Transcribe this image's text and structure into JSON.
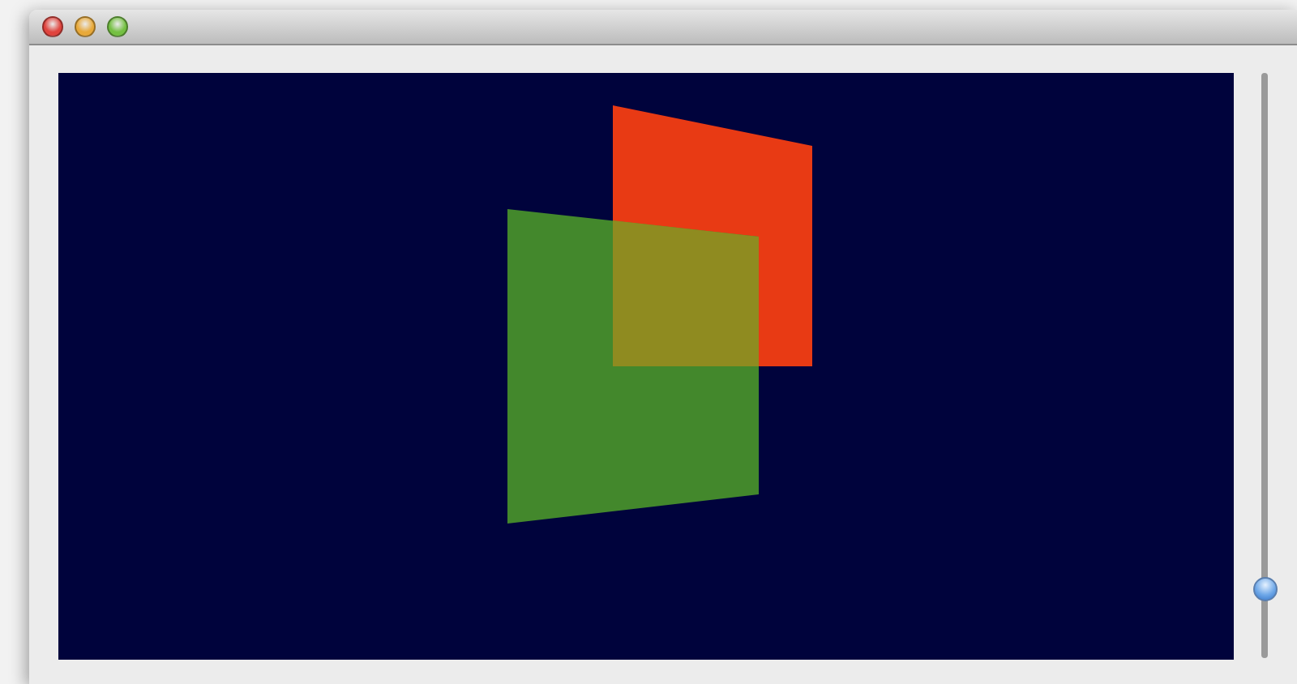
{
  "window": {
    "controls": [
      {
        "kind": "close"
      },
      {
        "kind": "minimize"
      },
      {
        "kind": "zoom"
      }
    ]
  },
  "slider": {
    "level": 0.1
  }
}
